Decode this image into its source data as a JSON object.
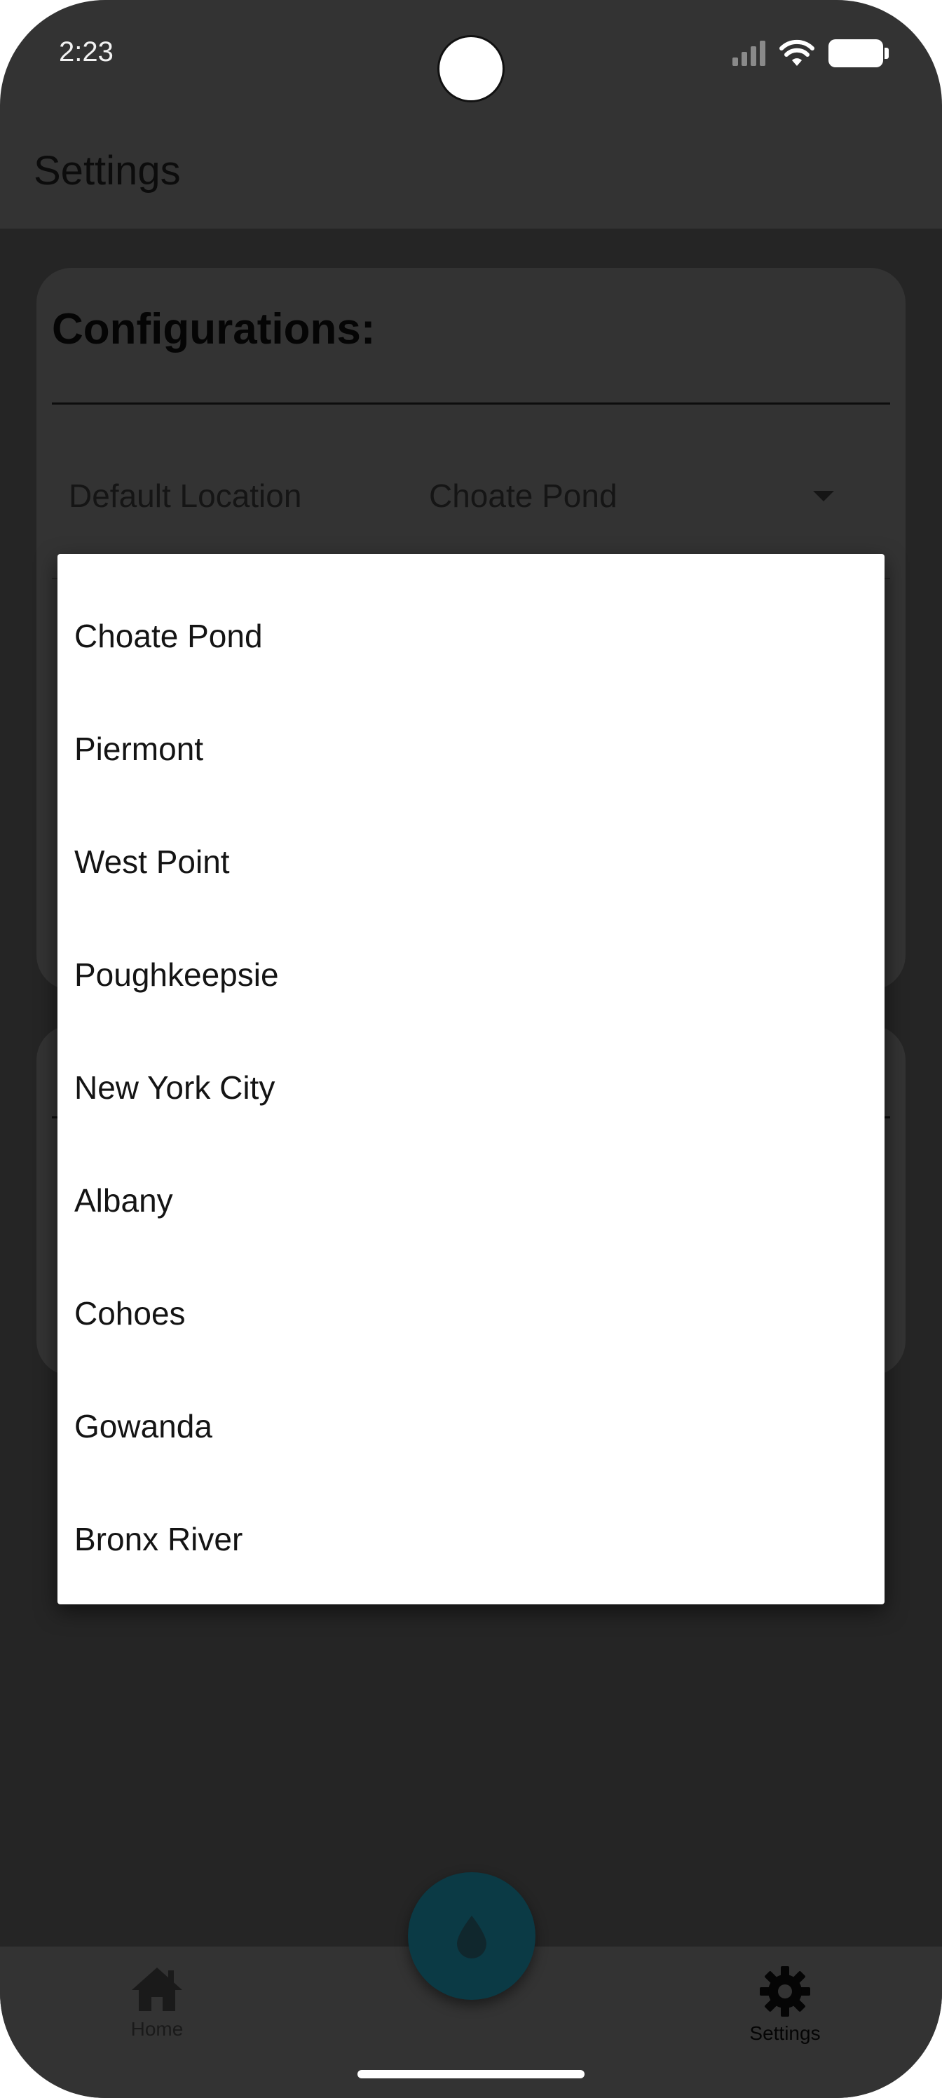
{
  "status_bar": {
    "time": "2:23"
  },
  "app_bar": {
    "title": "Settings"
  },
  "config_card": {
    "title": "Configurations:",
    "default_location_label": "Default Location",
    "default_location_value": "Choate Pond"
  },
  "dropdown": {
    "options": [
      "Choate Pond",
      "Piermont",
      "West Point",
      "Poughkeepsie",
      "New York City",
      "Albany",
      "Cohoes",
      "Gowanda",
      "Bronx River"
    ]
  },
  "bottom_nav": {
    "items": [
      {
        "label": "Home",
        "icon": "home-icon"
      },
      {
        "label": "Settings",
        "icon": "gear-icon"
      }
    ],
    "fab_icon": "water-drop-icon"
  },
  "colors": {
    "fab": "#0b3a45",
    "surface": "#333333",
    "background": "#252525",
    "menu": "#ffffff"
  }
}
